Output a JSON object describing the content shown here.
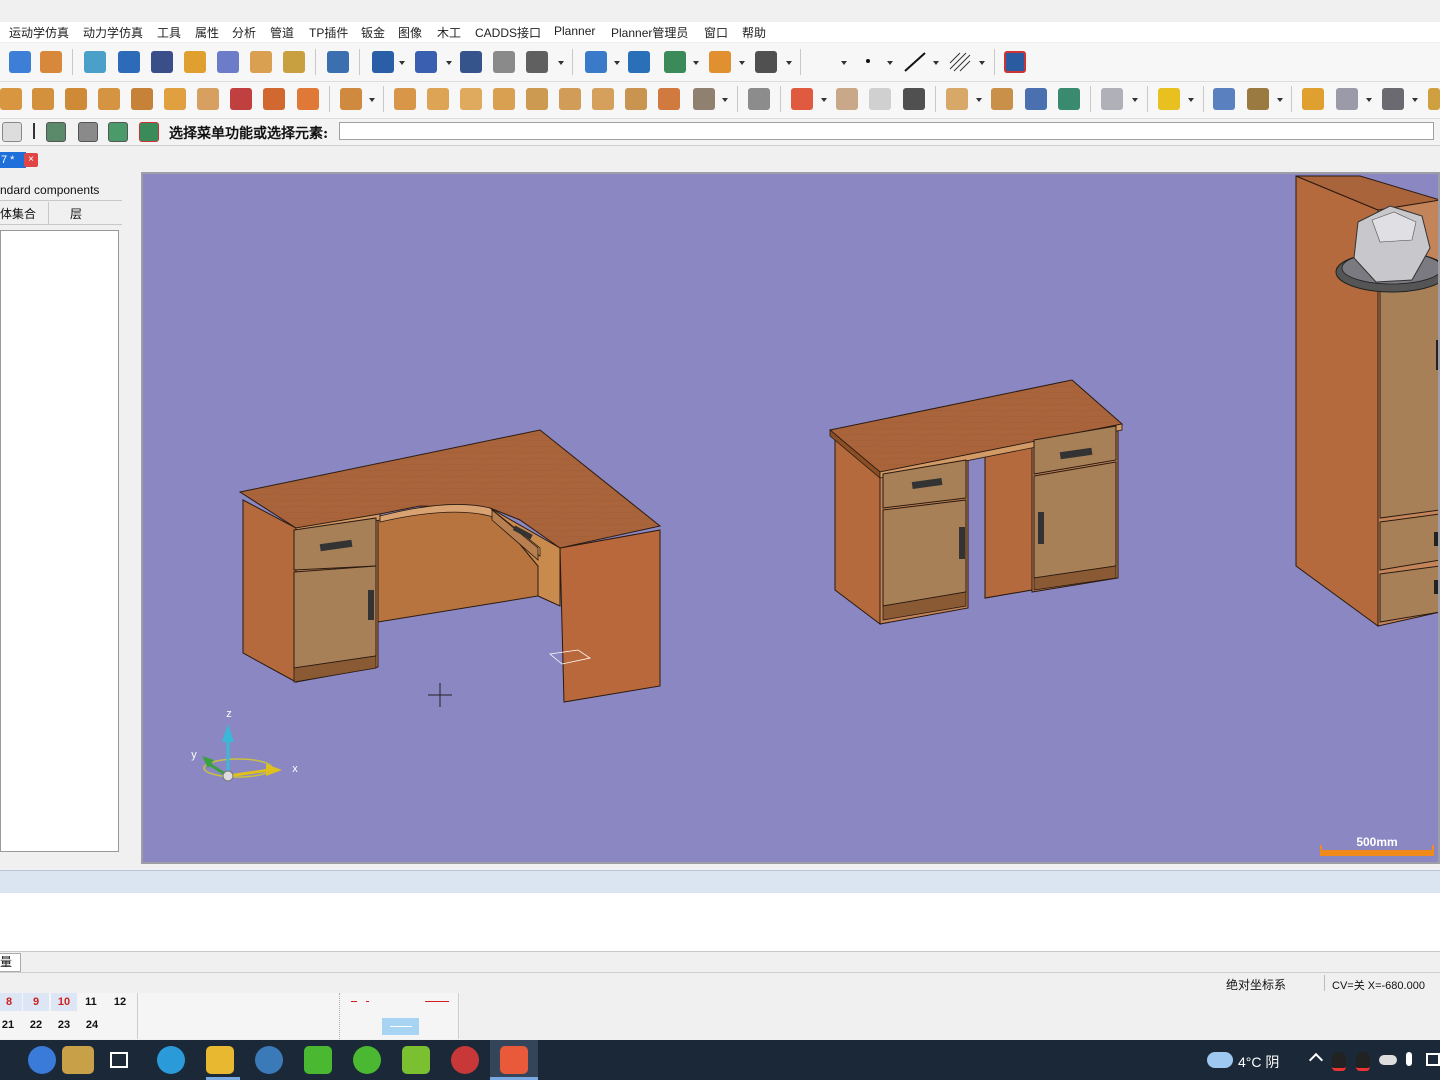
{
  "menu": [
    "运动学仿真",
    "动力学仿真",
    "工具",
    "属性",
    "分析",
    "管道",
    "TP插件",
    "钣金",
    "图像",
    "木工",
    "CADDS接口",
    "Planner",
    "Planner管理员",
    "窗口",
    "帮助"
  ],
  "command": {
    "label": "选择菜单功能或选择元素:",
    "value": ""
  },
  "document_tab": {
    "label": "7 *",
    "close": "×"
  },
  "left_panel": {
    "title": "ndard components",
    "tabs": [
      "体集合",
      "层"
    ]
  },
  "viewport": {
    "background": "#8a87c2",
    "scale_bar_label": "500mm",
    "axis_labels": {
      "z": "z",
      "y": "y",
      "x": "x"
    }
  },
  "output_tab": "量",
  "status": {
    "coord_system": "绝对坐标系",
    "cv": "CV=关 X=-680.000"
  },
  "layer_palette": {
    "row1": [
      "8",
      "9",
      "10",
      "11",
      "12"
    ],
    "row2": [
      "21",
      "22",
      "23",
      "24"
    ]
  },
  "taskbar": {
    "weather": "4°C 阴"
  },
  "colors": {
    "accent_tab": "#1e6fd9",
    "scale_bar": "#f08a1a",
    "taskbar": "#1b2837"
  }
}
